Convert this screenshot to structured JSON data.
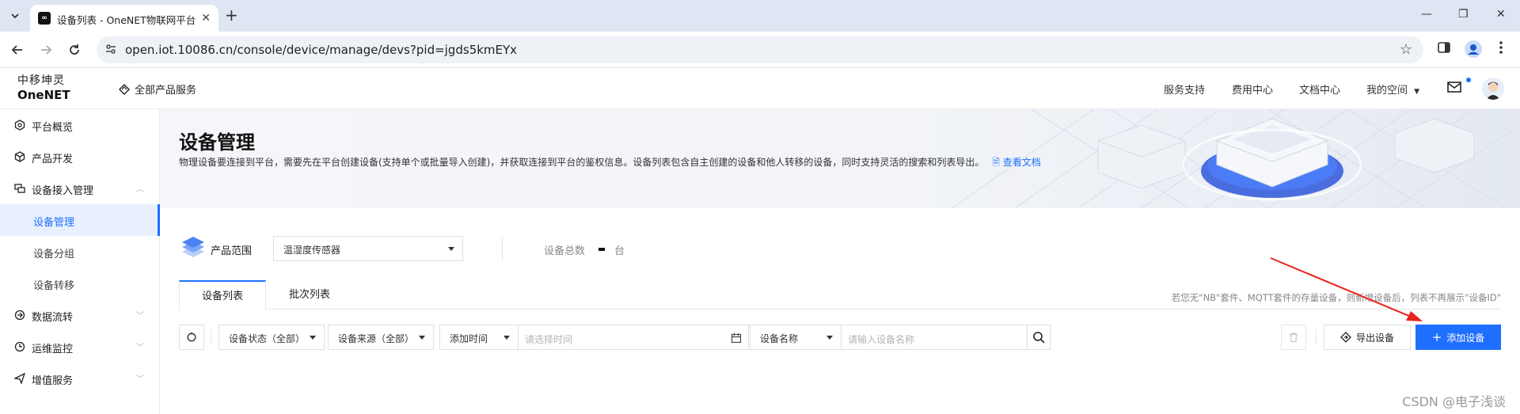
{
  "browser": {
    "tab_title": "设备列表 - OneNET物联网平台",
    "favicon_text": "∞",
    "url": "open.iot.10086.cn/console/device/manage/devs?pid=jgds5kmEYx"
  },
  "header": {
    "logo_cn": "中移坤灵",
    "logo_en": "OneNET",
    "all_products": "全部产品服务",
    "links": [
      "服务支持",
      "费用中心",
      "文档中心",
      "我的空间"
    ]
  },
  "sidebar": {
    "items": [
      {
        "label": "平台概览",
        "icon": "hexagon-icon"
      },
      {
        "label": "产品开发",
        "icon": "cube-icon"
      },
      {
        "label": "设备接入管理",
        "icon": "device-icon"
      },
      {
        "label": "设备管理",
        "sub": true,
        "active": true
      },
      {
        "label": "设备分组",
        "sub": true
      },
      {
        "label": "设备转移",
        "sub": true
      },
      {
        "label": "数据流转",
        "icon": "flow-icon"
      },
      {
        "label": "运维监控",
        "icon": "monitor-icon"
      },
      {
        "label": "增值服务",
        "icon": "send-icon"
      }
    ]
  },
  "banner": {
    "title": "设备管理",
    "desc": "物理设备要连接到平台，需要先在平台创建设备(支持单个或批量导入创建)，并获取连接到平台的鉴权信息。设备列表包含自主创建的设备和他人转移的设备，同时支持灵活的搜索和列表导出。",
    "link": "查看文档"
  },
  "scope": {
    "label": "产品范围",
    "selected": "温湿度传感器",
    "total_label": "设备总数",
    "total_unit": "台"
  },
  "tabs": [
    "设备列表",
    "批次列表"
  ],
  "tab_note": "若您无\"NB\"套件、MQTT套件的存量设备，则新增设备后，列表不再展示\"设备ID\"",
  "filters": {
    "status": "设备状态（全部）",
    "source": "设备来源（全部）",
    "time_field": "添加时间",
    "time_placeholder": "请选择时间",
    "name_field": "设备名称",
    "name_placeholder": "请输入设备名称"
  },
  "actions": {
    "export": "导出设备",
    "add": "添加设备"
  },
  "watermark": "CSDN @电子浅谈",
  "colors": {
    "accent": "#1f6fff",
    "annotation_arrow": "#e8231a"
  }
}
